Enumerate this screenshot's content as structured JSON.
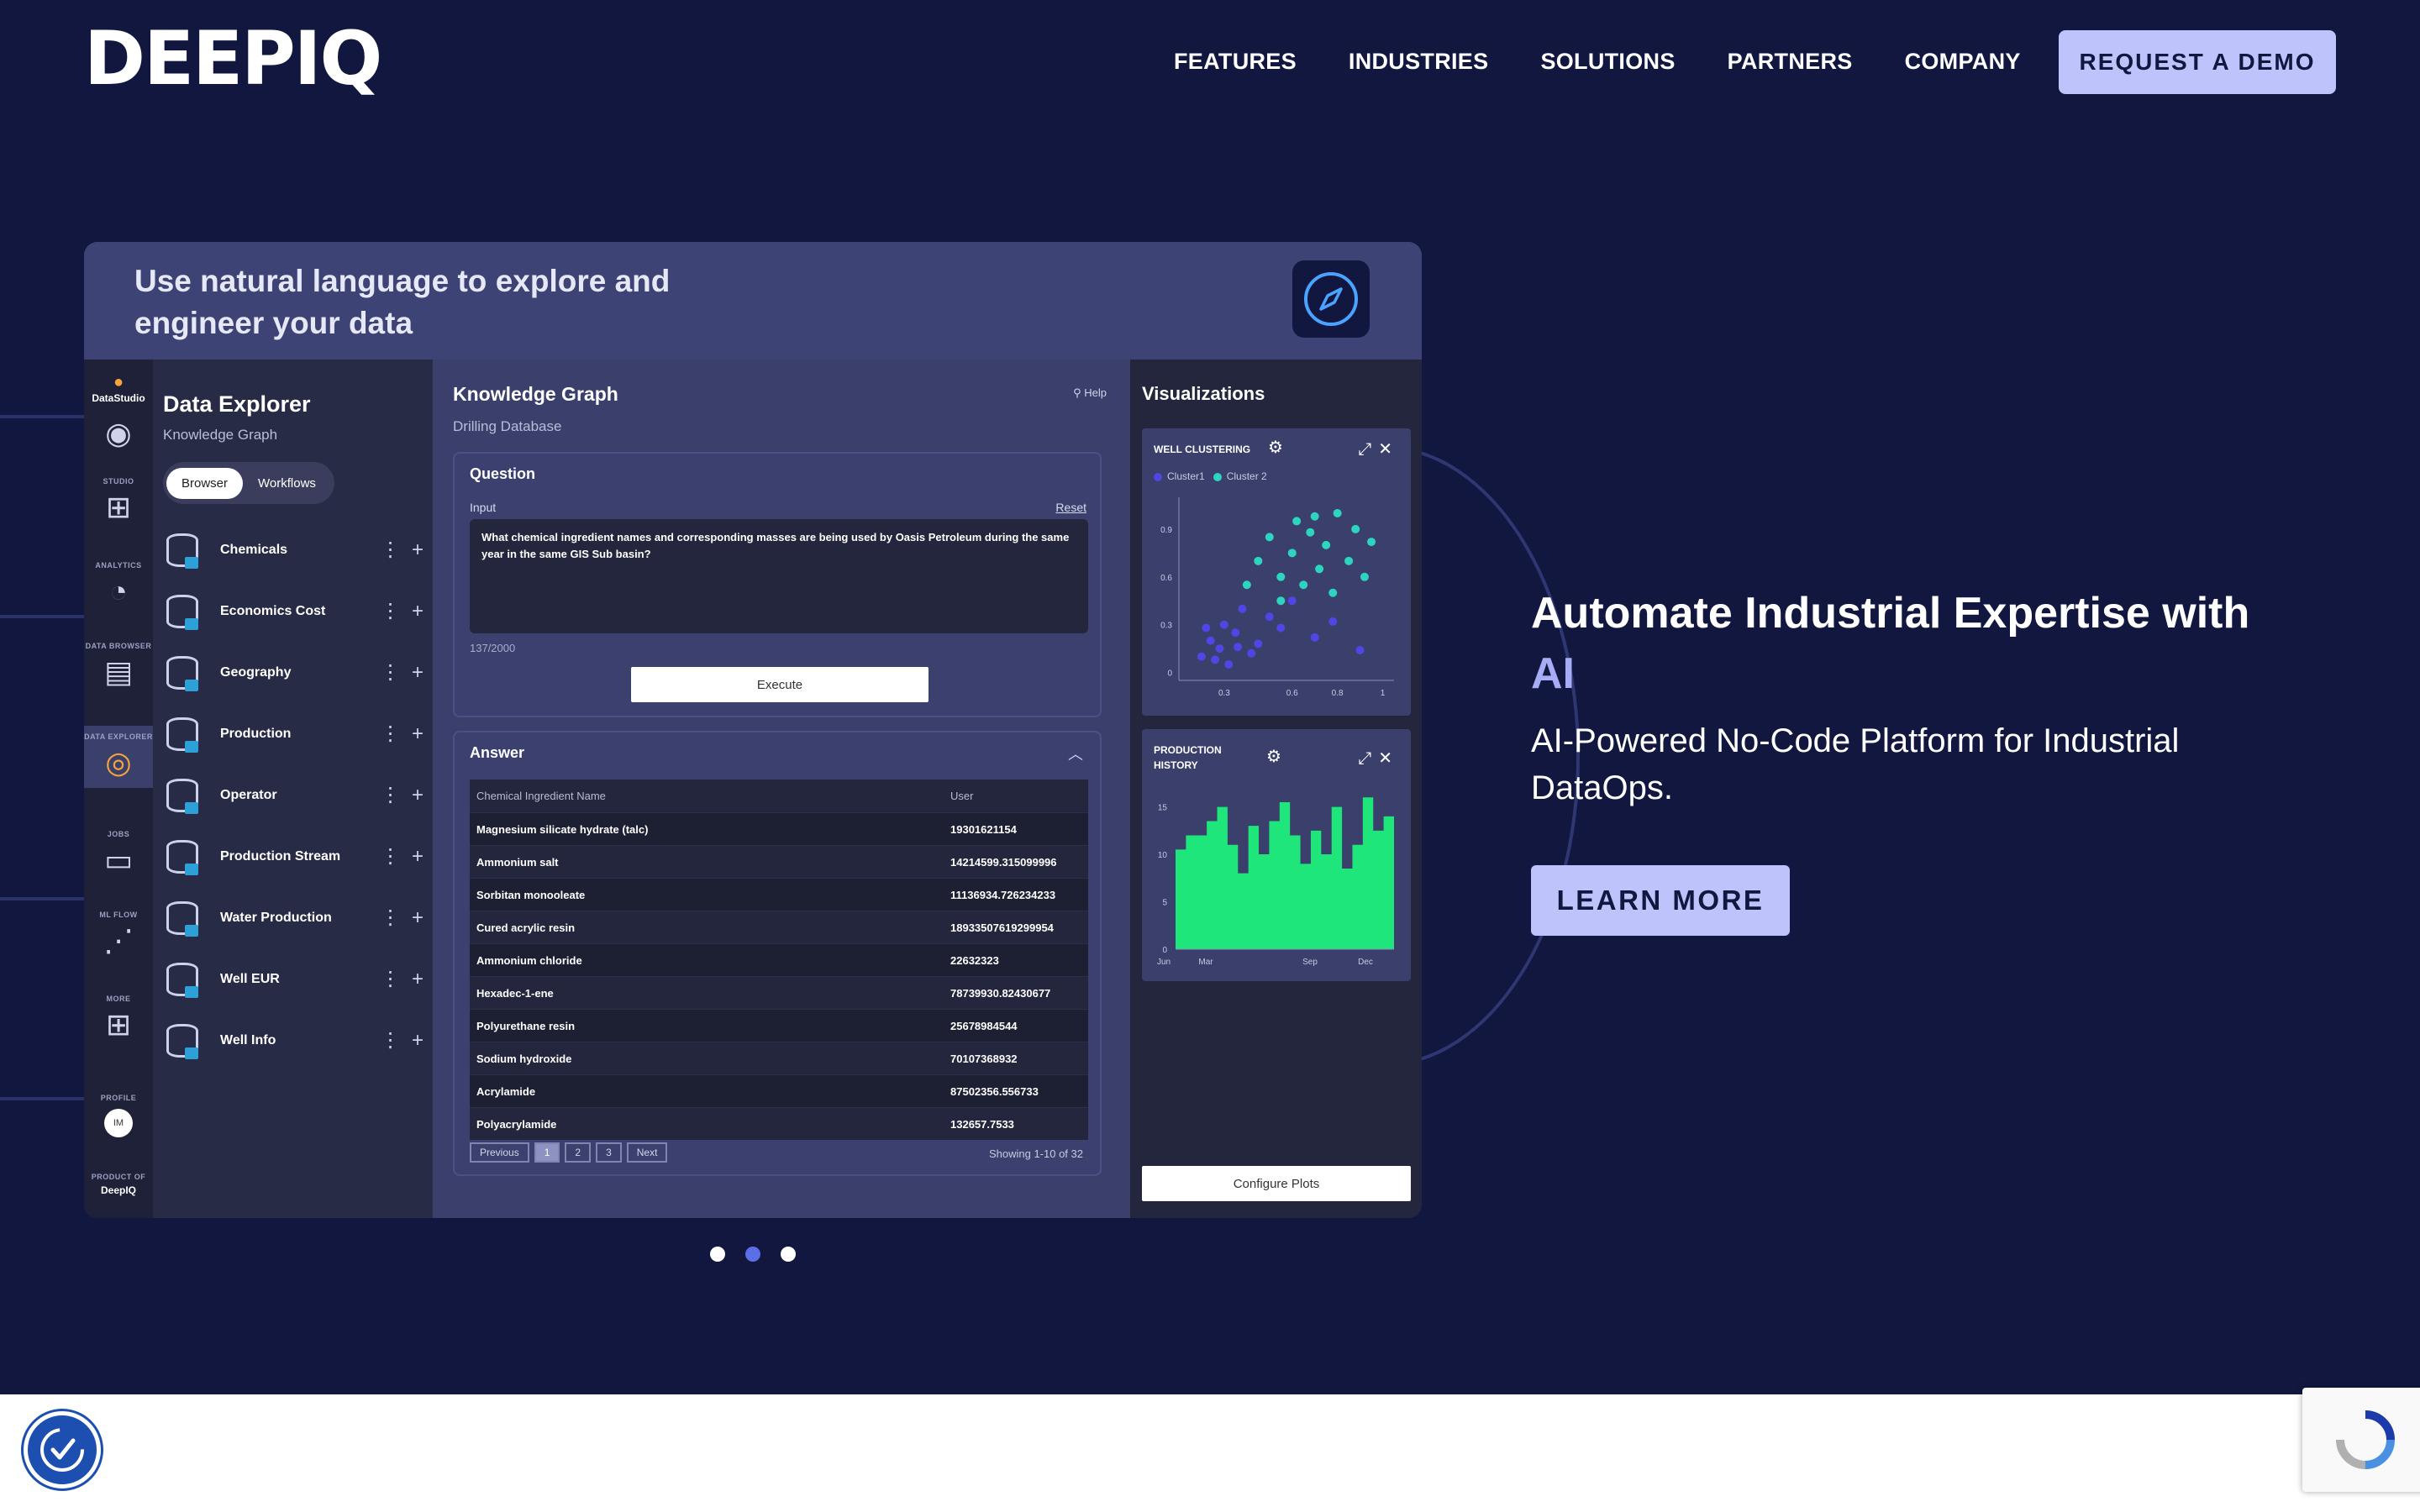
{
  "header": {
    "logo": "DEEPIQ",
    "nav": [
      "FEATURES",
      "INDUSTRIES",
      "SOLUTIONS",
      "PARTNERS",
      "COMPANY"
    ],
    "cta": "REQUEST A DEMO"
  },
  "product_frame": {
    "headline": "Use natural language to explore and engineer your data",
    "rail": {
      "brand": "DataStudio",
      "items": [
        "STUDIO",
        "ANALYTICS",
        "DATA BROWSER",
        "DATA EXPLORER",
        "JOBS",
        "ML FLOW",
        "MORE",
        "PROFILE"
      ],
      "avatar": "IM",
      "footer_line1": "PRODUCT OF",
      "footer_line2": "DeepIQ"
    },
    "explorer": {
      "title": "Data Explorer",
      "subtitle": "Knowledge Graph",
      "toggle": [
        "Browser",
        "Workflows"
      ],
      "datasets": [
        "Chemicals",
        "Economics Cost",
        "Geography",
        "Production",
        "Operator",
        "Production Stream",
        "Water Production",
        "Well EUR",
        "Well Info"
      ]
    },
    "knowledge_graph": {
      "title": "Knowledge Graph",
      "subtitle": "Drilling Database",
      "help": "Help",
      "question_label": "Question",
      "input_label": "Input",
      "reset": "Reset",
      "question": "What chemical ingredient names and corresponding masses are being used by Oasis Petroleum during the same year in the same GIS Sub basin?",
      "char_count": "137/2000",
      "execute": "Execute",
      "answer_label": "Answer",
      "columns": [
        "Chemical Ingredient Name",
        "User"
      ],
      "rows": [
        [
          "Magnesium silicate hydrate (talc)",
          "19301621154"
        ],
        [
          "Ammonium salt",
          "14214599.315099996"
        ],
        [
          "Sorbitan monooleate",
          "11136934.726234233"
        ],
        [
          "Cured acrylic resin",
          "18933507619299954"
        ],
        [
          "Ammonium chloride",
          "22632323"
        ],
        [
          "Hexadec-1-ene",
          "78739930.82430677"
        ],
        [
          "Polyurethane resin",
          "25678984544"
        ],
        [
          "Sodium hydroxide",
          "70107368932"
        ],
        [
          "Acrylamide",
          "87502356.556733"
        ],
        [
          "Polyacrylamide",
          "132657.7533"
        ]
      ],
      "pager": [
        "Previous",
        "1",
        "2",
        "3",
        "Next"
      ],
      "showing": "Showing 1-10 of 32"
    },
    "visualizations": {
      "title": "Visualizations",
      "configure": "Configure Plots",
      "colors": {
        "cluster1": "#4f46e5",
        "cluster2": "#2dd4bf",
        "area": "#1ee67a"
      }
    }
  },
  "hero": {
    "title": "Automate Industrial Expertise with",
    "title_accent": "AI",
    "subtitle": "AI-Powered No-Code Platform for Industrial DataOps.",
    "cta": "LEARN MORE"
  },
  "carousel": {
    "count": 3,
    "active_index": 1
  },
  "chart_data": [
    {
      "type": "scatter",
      "title": "WELL CLUSTERING",
      "legend": [
        "Cluster1",
        "Cluster 2"
      ],
      "y_ticks": [
        "0.9",
        "0.6",
        "0.3",
        "0"
      ],
      "x_ticks": [
        "0.3",
        "0.6",
        "0.8",
        "1"
      ],
      "xlim": [
        0.1,
        1.05
      ],
      "ylim": [
        -0.05,
        1.1
      ],
      "series": [
        {
          "name": "Cluster1",
          "points": [
            [
              0.2,
              0.1
            ],
            [
              0.24,
              0.2
            ],
            [
              0.28,
              0.15
            ],
            [
              0.3,
              0.3
            ],
            [
              0.35,
              0.25
            ],
            [
              0.38,
              0.4
            ],
            [
              0.32,
              0.05
            ],
            [
              0.45,
              0.18
            ],
            [
              0.5,
              0.35
            ],
            [
              0.55,
              0.28
            ],
            [
              0.6,
              0.45
            ],
            [
              0.42,
              0.12
            ],
            [
              0.7,
              0.22
            ],
            [
              0.78,
              0.32
            ],
            [
              0.9,
              0.14
            ],
            [
              0.26,
              0.08
            ],
            [
              0.36,
              0.16
            ],
            [
              0.22,
              0.28
            ]
          ]
        },
        {
          "name": "Cluster 2",
          "points": [
            [
              0.4,
              0.55
            ],
            [
              0.45,
              0.7
            ],
            [
              0.5,
              0.85
            ],
            [
              0.55,
              0.6
            ],
            [
              0.6,
              0.75
            ],
            [
              0.62,
              0.95
            ],
            [
              0.68,
              0.88
            ],
            [
              0.72,
              0.65
            ],
            [
              0.75,
              0.8
            ],
            [
              0.8,
              1.0
            ],
            [
              0.85,
              0.7
            ],
            [
              0.88,
              0.9
            ],
            [
              0.92,
              0.6
            ],
            [
              0.65,
              0.55
            ],
            [
              0.78,
              0.5
            ],
            [
              0.55,
              0.45
            ],
            [
              0.95,
              0.82
            ],
            [
              0.7,
              0.98
            ]
          ]
        }
      ]
    },
    {
      "type": "area",
      "title": "PRODUCTION HISTORY",
      "y_ticks": [
        "15",
        "10",
        "5",
        "0"
      ],
      "x_ticks": [
        "Jun",
        "Mar",
        "Sep",
        "Dec"
      ],
      "ylim": [
        0,
        17
      ],
      "values": [
        10.5,
        12,
        12,
        13.5,
        15,
        11,
        8,
        13,
        10,
        13.5,
        15.5,
        12,
        9,
        12.5,
        10,
        15,
        8.5,
        11,
        16,
        12.5,
        14
      ]
    }
  ]
}
